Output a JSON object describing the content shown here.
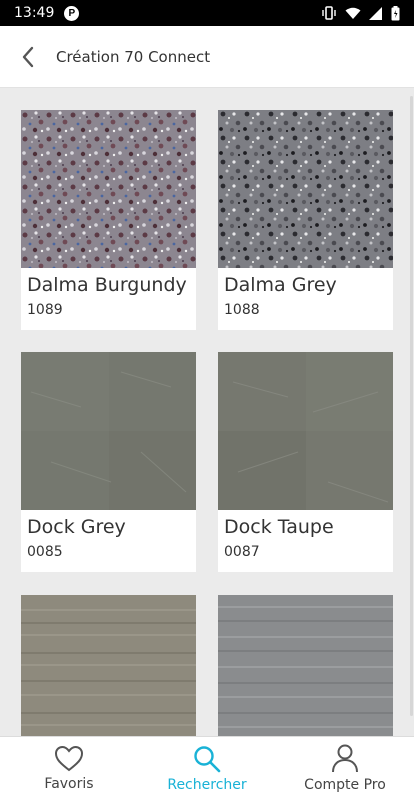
{
  "status_bar": {
    "time": "13:49"
  },
  "header": {
    "title": "Création 70 Connect"
  },
  "products": [
    {
      "name": "Dalma Burgundy",
      "code": "1089",
      "swatch": "terrazzo-burgundy"
    },
    {
      "name": "Dalma Grey",
      "code": "1088",
      "swatch": "terrazzo-grey"
    },
    {
      "name": "Dock Grey",
      "code": "0085",
      "swatch": "concrete-grey"
    },
    {
      "name": "Dock Taupe",
      "code": "0087",
      "swatch": "concrete-taupe"
    },
    {
      "name": "",
      "code": "",
      "swatch": "wood-taupe"
    },
    {
      "name": "",
      "code": "",
      "swatch": "wood-grey"
    }
  ],
  "bottom_nav": [
    {
      "label": "Favoris",
      "icon": "heart-icon",
      "active": false
    },
    {
      "label": "Rechercher",
      "icon": "search-icon",
      "active": true
    },
    {
      "label": "Compte Pro",
      "icon": "person-icon",
      "active": false
    }
  ],
  "colors": {
    "accent": "#19b2d6",
    "background": "#ebebeb"
  }
}
